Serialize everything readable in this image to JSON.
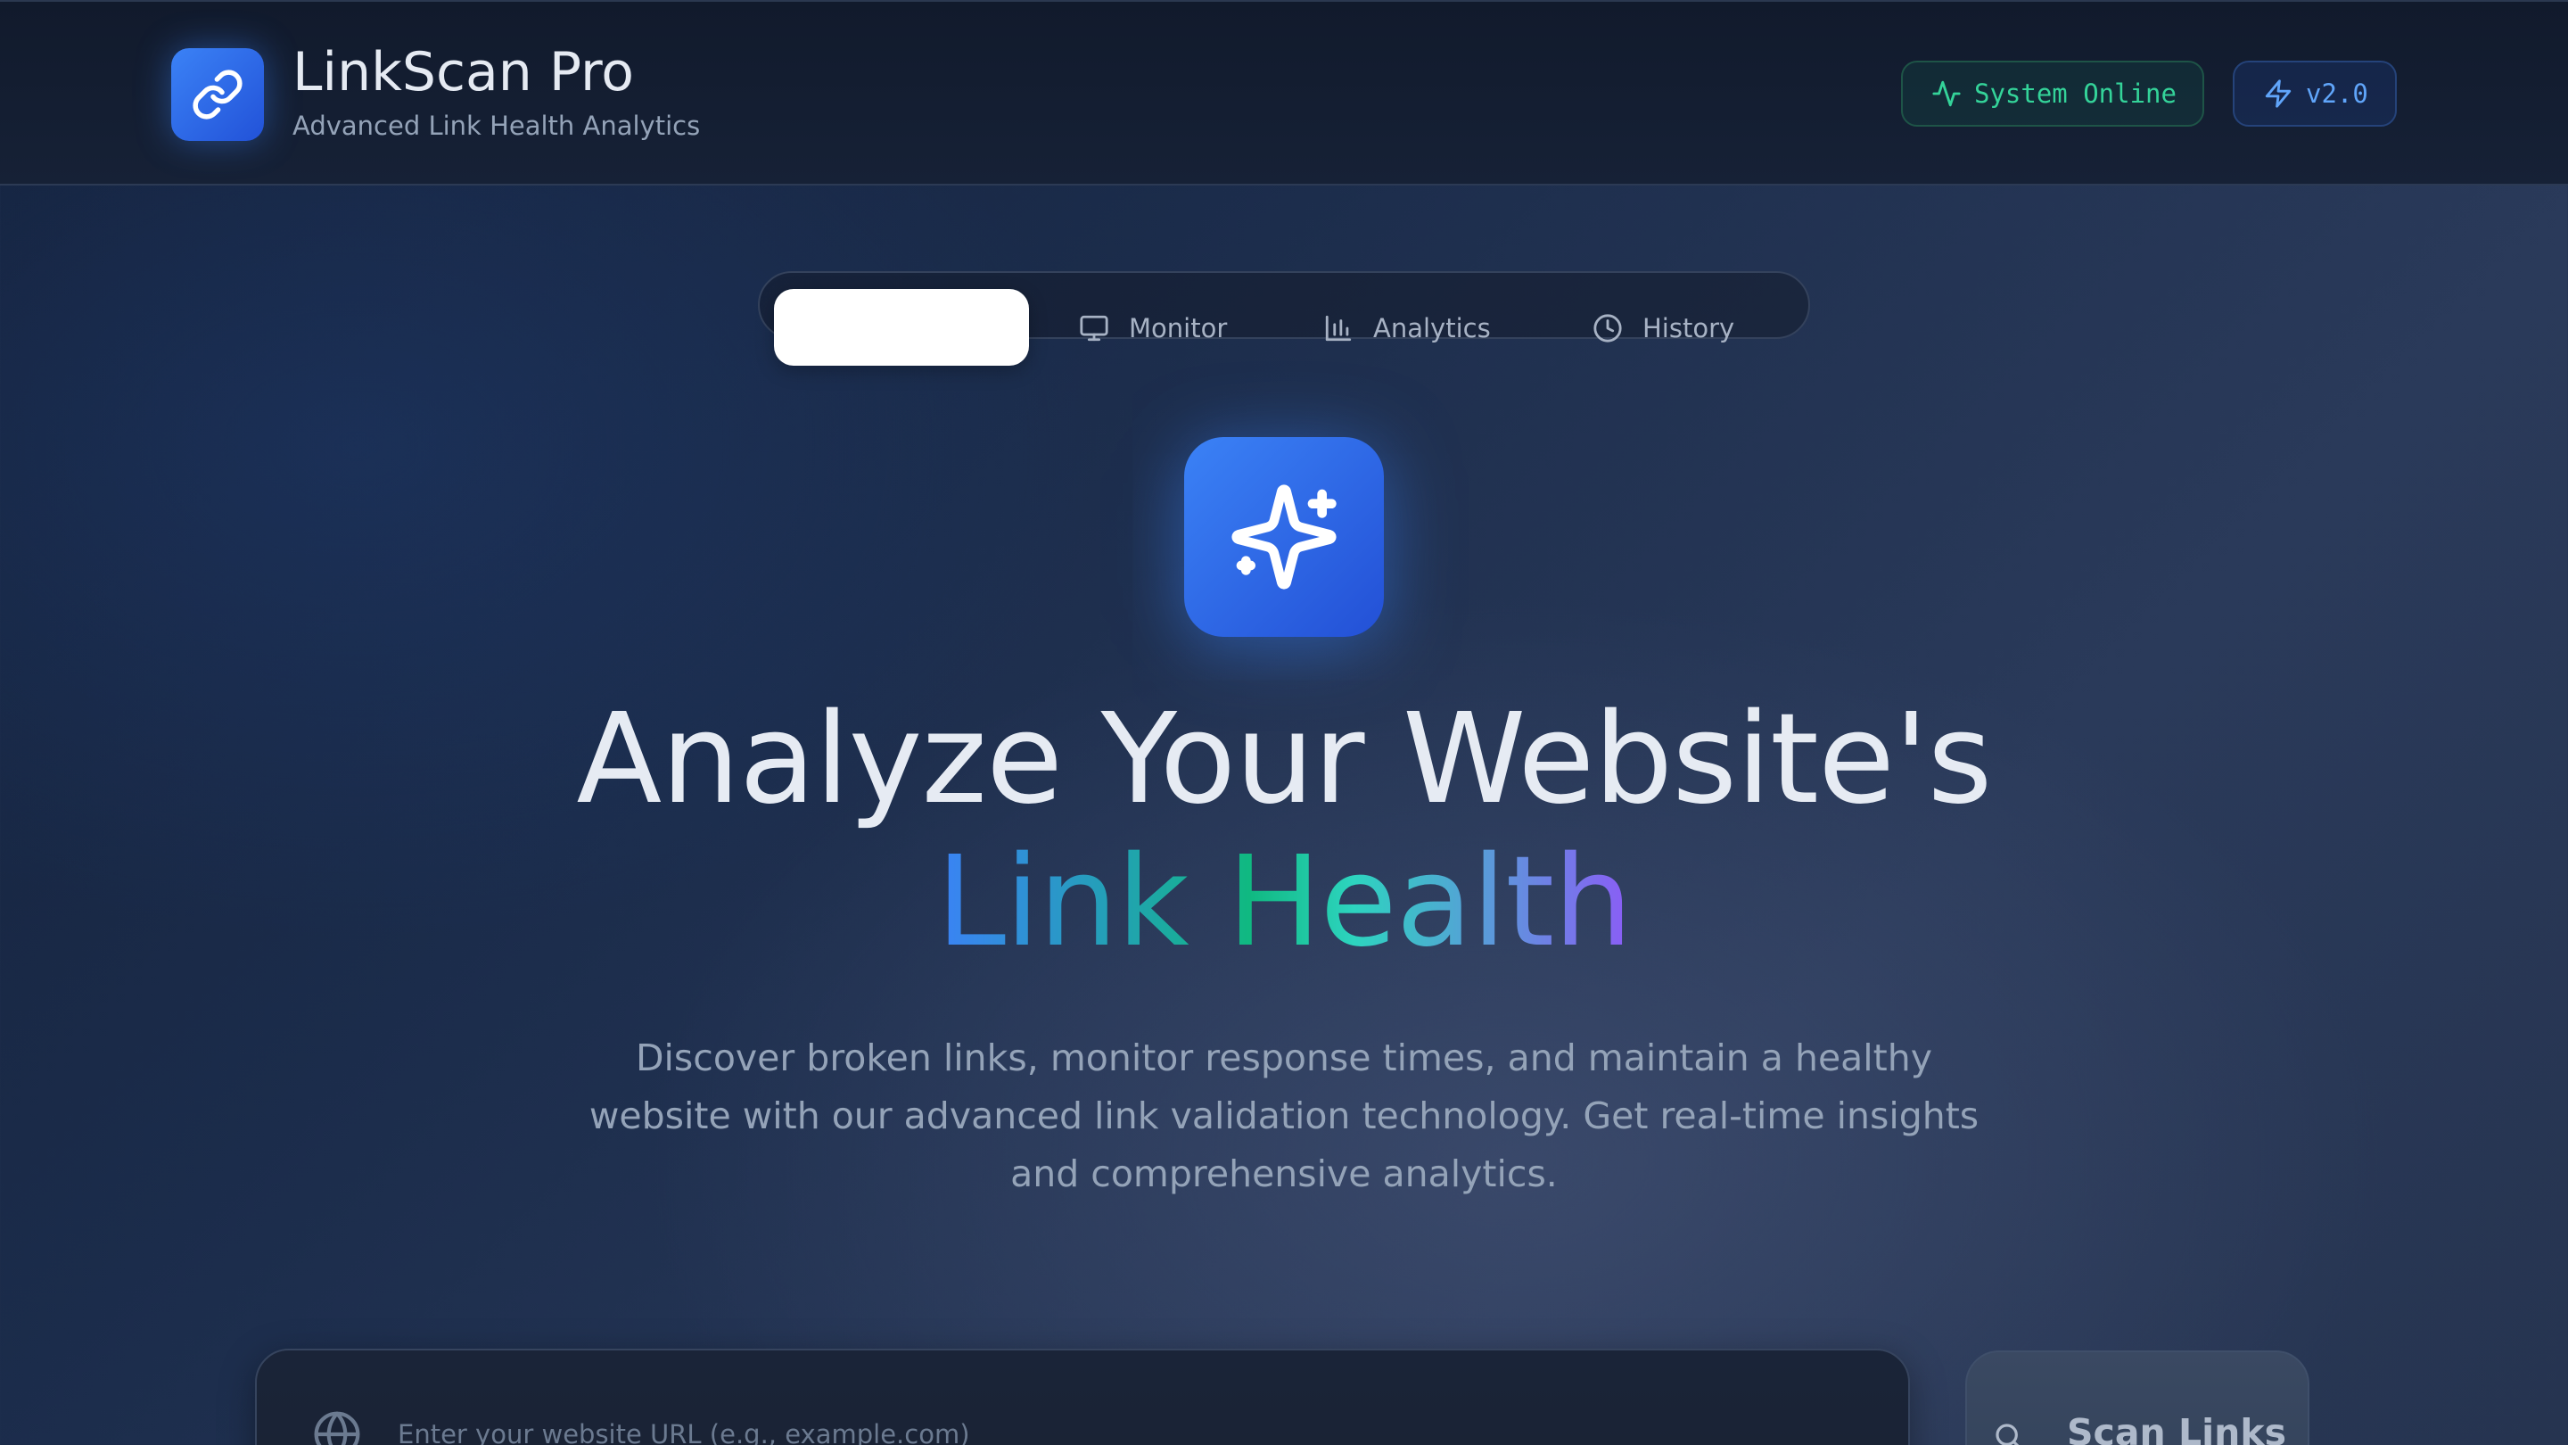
{
  "header": {
    "app_title": "LinkScan Pro",
    "app_subtitle": "Advanced Link Health Analytics",
    "status_badge": "System Online",
    "version_badge": "v2.0",
    "logo_icon": "link-icon"
  },
  "tabs": [
    {
      "label": "",
      "icon": "sparkles-icon",
      "active": true
    },
    {
      "label": "Monitor",
      "icon": "monitor-icon"
    },
    {
      "label": "Analytics",
      "icon": "bar-chart-icon"
    },
    {
      "label": "History",
      "icon": "clock-icon"
    }
  ],
  "hero": {
    "icon": "sparkles-icon",
    "title_line1": "Analyze Your Website's",
    "title_line2": "Link Health",
    "description": "Discover broken links, monitor response times, and maintain a healthy website with our advanced link validation technology. Get real-time insights and comprehensive analytics."
  },
  "search": {
    "placeholder": "Enter your website URL (e.g., example.com)",
    "value": "",
    "icon": "globe-icon"
  },
  "scan_button": {
    "label": "Scan Links",
    "icon": "search-icon"
  },
  "colors": {
    "accent": "#3b82f6",
    "online": "#34d399",
    "gradient": [
      "#3b82f6",
      "#10b981",
      "#8b5cf6"
    ]
  }
}
